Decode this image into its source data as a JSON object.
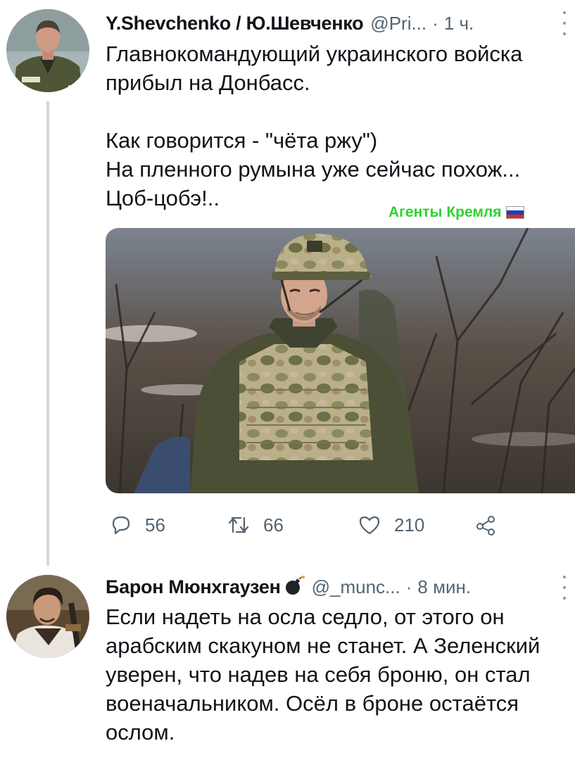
{
  "tweet1": {
    "name": "Y.Shevchenko / Ю.Шевченко",
    "handle": "@Pri...",
    "separator": "·",
    "time": "1 ч.",
    "text": "Главнокомандующий украинского войска прибыл на Донбасс.\n\nКак говорится - \"чёта ржу\")\nНа пленного румына уже сейчас похож...\nЦоб-цобэ!..",
    "watermark": "Агенты Кремля",
    "actions": {
      "reply_count": "56",
      "retweet_count": "66",
      "like_count": "210"
    }
  },
  "tweet2": {
    "name": "Барон Мюнхгаузен",
    "handle": "@_munc...",
    "separator": "·",
    "time": "8 мин.",
    "text": "Если надеть на осла седло, от этого он арабским скакуном не станет. А Зеленский уверен, что надев на себя броню, он стал военачальником. Осёл в броне остаётся ослом."
  },
  "icons": {
    "reply": "reply-icon",
    "retweet": "retweet-icon",
    "like": "like-icon",
    "share": "share-icon",
    "more": "more-options-icon",
    "name_badge": "bomb-icon"
  },
  "colors": {
    "text": "#0f1419",
    "secondary": "#536471",
    "thread_line": "#cfd9de",
    "watermark": "#2fd12f"
  }
}
